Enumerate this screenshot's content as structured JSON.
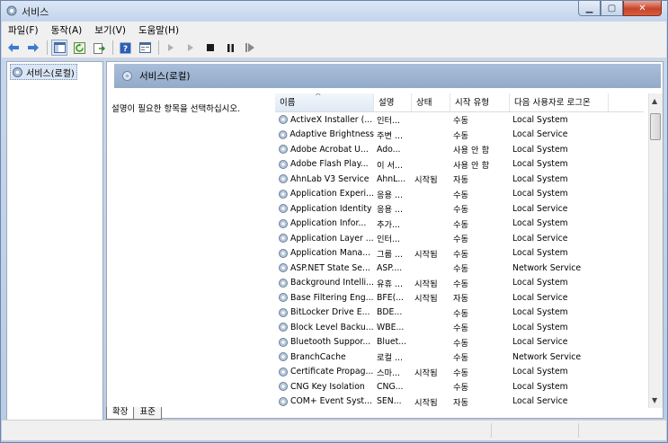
{
  "window": {
    "title": "서비스"
  },
  "menu": [
    "파일(F)",
    "동작(A)",
    "보기(V)",
    "도움말(H)"
  ],
  "toolbar": {
    "icons": [
      "back-icon",
      "forward-icon",
      "show-tree-icon",
      "refresh-icon",
      "export-icon",
      "help-icon",
      "properties-icon",
      "start-icon",
      "start-alt-icon",
      "stop-icon",
      "pause-icon",
      "restart-icon"
    ]
  },
  "tree": {
    "root_label": "서비스(로컬)"
  },
  "pane": {
    "header": "서비스(로컬)",
    "description_prompt": "설명이 필요한 항목을 선택하십시오."
  },
  "columns": [
    "이름",
    "설명",
    "상태",
    "시작 유형",
    "다음 사용자로 로그온"
  ],
  "rows": [
    [
      "ActiveX Installer (...",
      "인터...",
      "",
      "수동",
      "Local System"
    ],
    [
      "Adaptive Brightness",
      "주변 ...",
      "",
      "수동",
      "Local Service"
    ],
    [
      "Adobe Acrobat U...",
      "Ado...",
      "",
      "사용 안 함",
      "Local System"
    ],
    [
      "Adobe Flash Play...",
      "이 서...",
      "",
      "사용 안 함",
      "Local System"
    ],
    [
      "AhnLab V3 Service",
      "AhnL...",
      "시작됨",
      "자동",
      "Local System"
    ],
    [
      "Application Experi...",
      "응용 ...",
      "",
      "수동",
      "Local System"
    ],
    [
      "Application Identity",
      "응용 ...",
      "",
      "수동",
      "Local Service"
    ],
    [
      "Application Infor...",
      "추가...",
      "",
      "수동",
      "Local System"
    ],
    [
      "Application Layer ...",
      "인터...",
      "",
      "수동",
      "Local Service"
    ],
    [
      "Application Mana...",
      "그룹 ...",
      "시작됨",
      "수동",
      "Local System"
    ],
    [
      "ASP.NET State Se...",
      "ASP....",
      "",
      "수동",
      "Network Service"
    ],
    [
      "Background Intelli...",
      "유휴 ...",
      "시작됨",
      "수동",
      "Local System"
    ],
    [
      "Base Filtering Eng...",
      "BFE(...",
      "시작됨",
      "자동",
      "Local Service"
    ],
    [
      "BitLocker Drive E...",
      "BDE...",
      "",
      "수동",
      "Local System"
    ],
    [
      "Block Level Backu...",
      "WBE...",
      "",
      "수동",
      "Local System"
    ],
    [
      "Bluetooth Suppor...",
      "Bluet...",
      "",
      "수동",
      "Local Service"
    ],
    [
      "BranchCache",
      "로컬 ...",
      "",
      "수동",
      "Network Service"
    ],
    [
      "Certificate Propag...",
      "스마...",
      "시작됨",
      "수동",
      "Local System"
    ],
    [
      "CNG Key Isolation",
      "CNG...",
      "",
      "수동",
      "Local System"
    ],
    [
      "COM+ Event Syst...",
      "SEN...",
      "시작됨",
      "자동",
      "Local Service"
    ]
  ],
  "tabs": [
    "확장",
    "표준"
  ],
  "colors": {
    "header_blue": "#9db4d2",
    "title_bar": "#c3d5ec",
    "close_red": "#c8442b"
  }
}
